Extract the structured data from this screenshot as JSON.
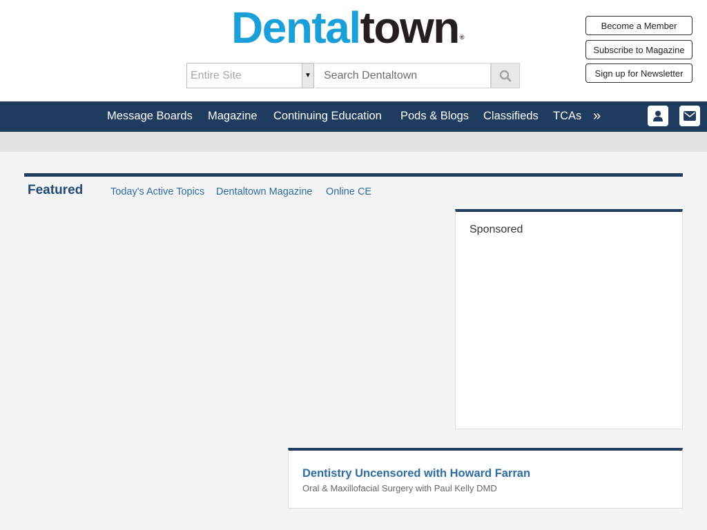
{
  "logo": {
    "part1": "Dental",
    "part2": "town",
    "reg": "®"
  },
  "search": {
    "scope_value": "Entire Site",
    "placeholder": "Search Dentaltown",
    "button_icon": "search-icon",
    "dropdown_icon": "caret-down-icon"
  },
  "header_buttons": {
    "member": "Become a Member",
    "magazine": "Subscribe to Magazine",
    "newsletter": "Sign up for Newsletter"
  },
  "nav": {
    "items": [
      {
        "label": "Message Boards"
      },
      {
        "label": "Magazine"
      },
      {
        "label": "Continuing Education"
      },
      {
        "label": "Pods & Blogs"
      },
      {
        "label": "Classifieds"
      },
      {
        "label": "TCAs"
      }
    ],
    "more": "»",
    "user_icon": "user-icon",
    "mail_icon": "envelope-icon"
  },
  "featured": {
    "title": "Featured",
    "links": [
      {
        "label": "Today's Active Topics"
      },
      {
        "label": "Dentaltown Magazine"
      },
      {
        "label": "Online CE"
      }
    ]
  },
  "sponsored": {
    "label": "Sponsored"
  },
  "podcast_card": {
    "title": "Dentistry Uncensored with Howard Farran",
    "subtitle": "Oral & Maxillofacial Surgery with Paul Kelly DMD"
  },
  "colors": {
    "nav_bg": "#1f3c5e",
    "logo_cyan": "#1a9fd9",
    "logo_dark": "#231f20",
    "link_blue": "#2d6ca2",
    "page_bg": "#f4f4f4"
  }
}
